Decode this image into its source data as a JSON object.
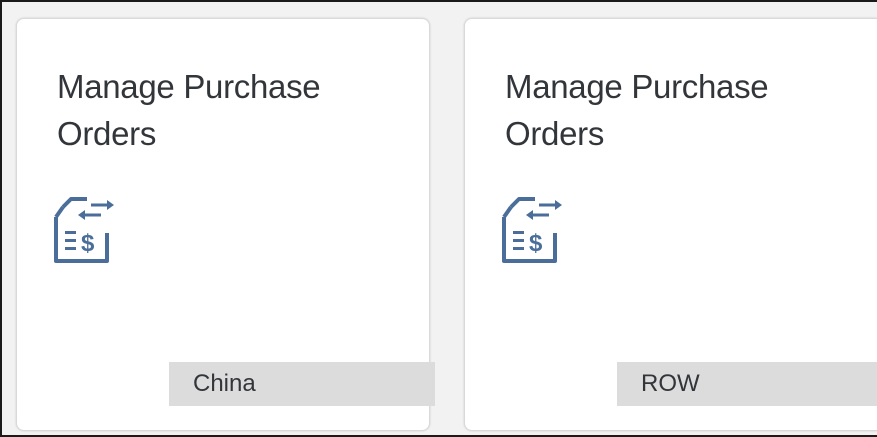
{
  "tiles": [
    {
      "title": "Manage Purchase Orders",
      "icon": "purchase-order-icon",
      "footer": "China"
    },
    {
      "title": "Manage Purchase Orders",
      "icon": "purchase-order-icon",
      "footer": "ROW"
    }
  ],
  "colors": {
    "icon": "#4a6e99",
    "title_text": "#32363a",
    "footer_bg": "#dcdcdc",
    "tile_bg": "#ffffff",
    "page_bg": "#f2f2f2"
  }
}
